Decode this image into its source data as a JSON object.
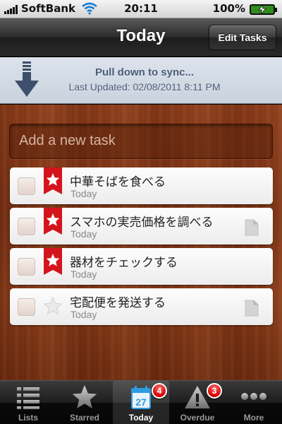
{
  "status_bar": {
    "carrier": "SoftBank",
    "time": "20:11",
    "battery_percent": "100%",
    "battery_level": 1.0,
    "icons": [
      "signal-icon",
      "wifi-icon",
      "battery-charging-icon"
    ]
  },
  "nav": {
    "title": "Today",
    "edit_button": "Edit Tasks"
  },
  "sync": {
    "title": "Pull down to sync...",
    "last_updated": "Last Updated: 02/08/2011 8:11 PM",
    "icon": "arrow-down-icon"
  },
  "add_task": {
    "placeholder": "Add a new task"
  },
  "tasks": [
    {
      "title": "中華そばを食べる",
      "due": "Today",
      "starred": true,
      "has_note": false
    },
    {
      "title": "スマホの実売価格を調べる",
      "due": "Today",
      "starred": true,
      "has_note": true
    },
    {
      "title": "器材をチェックする",
      "due": "Today",
      "starred": true,
      "has_note": false
    },
    {
      "title": "宅配便を発送する",
      "due": "Today",
      "starred": false,
      "has_note": true
    }
  ],
  "tab_bar": {
    "tabs": [
      {
        "label": "Lists",
        "icon": "list-icon",
        "active": false
      },
      {
        "label": "Starred",
        "icon": "star-icon",
        "active": false
      },
      {
        "label": "Today",
        "icon": "calendar-icon",
        "active": true,
        "badge": "4",
        "calendar_day": "27"
      },
      {
        "label": "Overdue",
        "icon": "warning-icon",
        "active": false,
        "badge": "3"
      },
      {
        "label": "More",
        "icon": "more-dots-icon",
        "active": false
      }
    ]
  },
  "colors": {
    "star_red": "#d4141c",
    "badge_red": "#d60000",
    "sync_text": "#4b5d77",
    "wood": "#7a3113"
  }
}
